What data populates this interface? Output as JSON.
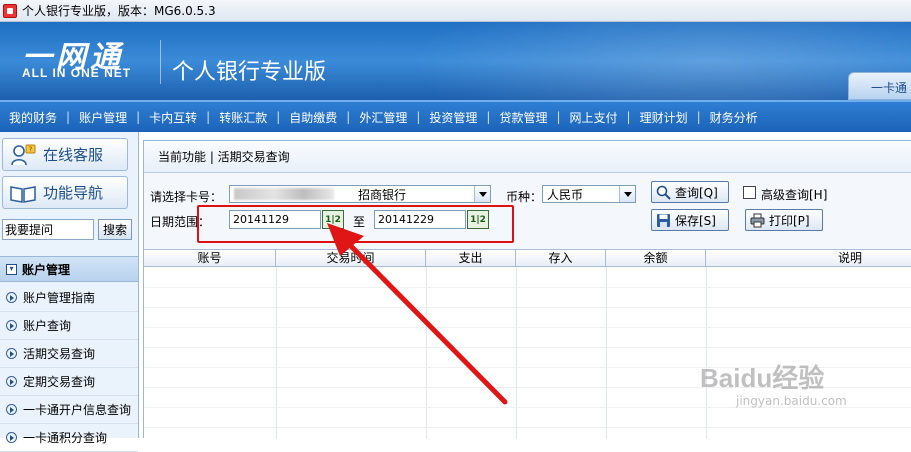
{
  "window": {
    "title": "个人银行专业版，版本：MG6.0.5.3"
  },
  "banner": {
    "logo_main": "一网通",
    "logo_sub": "ALL IN ONE NET",
    "product_title": "个人银行专业版",
    "right_tab": "一卡通"
  },
  "menu": {
    "items": [
      "我的财务",
      "账户管理",
      "卡内互转",
      "转账汇款",
      "自助缴费",
      "外汇管理",
      "投资管理",
      "贷款管理",
      "网上支付",
      "理财计划",
      "财务分析"
    ]
  },
  "sidebar": {
    "online_service": "在线客服",
    "feature_nav": "功能导航",
    "search_placeholder": "我要提问",
    "search_button": "搜索",
    "section_title": "账户管理",
    "items": [
      "账户管理指南",
      "账户查询",
      "活期交易查询",
      "定期交易查询",
      "一卡通开户信息查询",
      "一卡通积分查询"
    ]
  },
  "content": {
    "breadcrumb": "当前功能 | 活期交易查询",
    "card_label": "请选择卡号：",
    "card_bank": "招商银行",
    "currency_label": "币种：",
    "currency_value": "人民币",
    "query_button": "查询[Q]",
    "advanced_query_label": "高级查询[H]",
    "advanced_query_checked": false,
    "save_button": "保存[S]",
    "print_button": "打印[P]",
    "date_range_label": "日期范围：",
    "date_from": "20141129",
    "date_to_label": "至",
    "date_to": "20141229",
    "calendar_button": "1|2"
  },
  "table": {
    "columns": [
      "账号",
      "交易时间",
      "支出",
      "存入",
      "余额",
      "说明"
    ],
    "rows": []
  },
  "watermark": {
    "text": "Baidu经验",
    "sub": "jingyan.baidu.com"
  },
  "colors": {
    "banner": "#2f7ed3",
    "annotation": "#dd1111",
    "accent": "#1f4f8a"
  }
}
